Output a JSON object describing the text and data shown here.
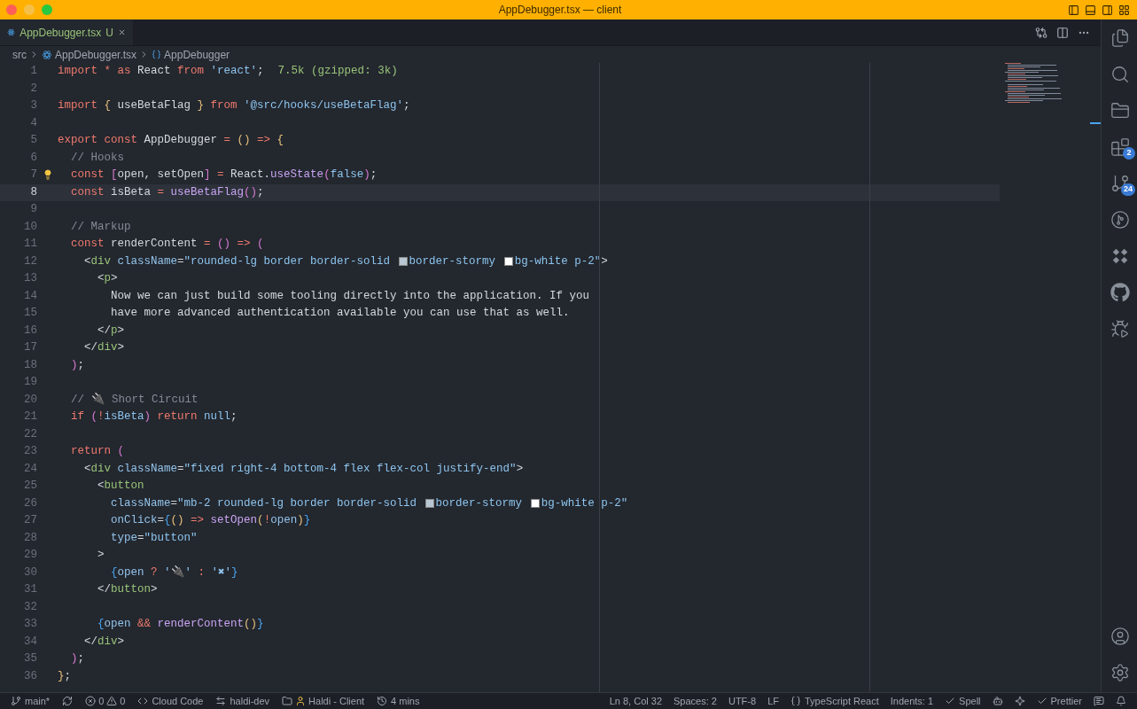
{
  "window": {
    "title": "AppDebugger.tsx — client"
  },
  "tabs": [
    {
      "label": "AppDebugger.tsx",
      "status": "U",
      "selected": true
    }
  ],
  "breadcrumb": [
    "src",
    "AppDebugger.tsx",
    "AppDebugger"
  ],
  "lines": [
    {
      "number": "1",
      "current": false,
      "tokens": [
        {
          "kind": "kw",
          "text": "import "
        },
        {
          "kind": "op",
          "text": "* "
        },
        {
          "kind": "kw",
          "text": "as "
        },
        {
          "kind": "id",
          "text": "React "
        },
        {
          "kind": "kw",
          "text": "from "
        },
        {
          "kind": "str",
          "text": "'react'"
        },
        {
          "kind": "id",
          "text": ";"
        },
        {
          "kind": "hint",
          "text": "7.5k (gzipped: 3k)"
        }
      ]
    },
    {
      "number": "2",
      "current": false
    },
    {
      "number": "3",
      "current": false,
      "tokens": [
        {
          "kind": "kw",
          "text": "import "
        },
        {
          "kind": "b1",
          "text": "{ "
        },
        {
          "kind": "id",
          "text": "useBetaFlag "
        },
        {
          "kind": "b1",
          "text": "} "
        },
        {
          "kind": "kw",
          "text": "from "
        },
        {
          "kind": "str",
          "text": "'@src/hooks/useBetaFlag'"
        },
        {
          "kind": "id",
          "text": ";"
        }
      ]
    },
    {
      "number": "4",
      "current": false
    },
    {
      "number": "5",
      "current": false,
      "tokens": [
        {
          "kind": "kw",
          "text": "export const "
        },
        {
          "kind": "id",
          "text": "AppDebugger "
        },
        {
          "kind": "op",
          "text": "= "
        },
        {
          "kind": "b1",
          "text": "() "
        },
        {
          "kind": "op",
          "text": "=> "
        },
        {
          "kind": "b1",
          "text": "{"
        }
      ]
    },
    {
      "number": "6",
      "current": false,
      "tokens": [
        {
          "kind": "com",
          "text": "  // Hooks"
        }
      ]
    },
    {
      "number": "7",
      "current": false,
      "lightbulb": true,
      "tokens": [
        {
          "kind": "kw",
          "text": "  const "
        },
        {
          "kind": "b2",
          "text": "["
        },
        {
          "kind": "id",
          "text": "open, setOpen"
        },
        {
          "kind": "b2",
          "text": "] "
        },
        {
          "kind": "op",
          "text": "= "
        },
        {
          "kind": "id",
          "text": "React."
        },
        {
          "kind": "fn",
          "text": "useState"
        },
        {
          "kind": "b2",
          "text": "("
        },
        {
          "kind": "var",
          "text": "false"
        },
        {
          "kind": "b2",
          "text": ")"
        },
        {
          "kind": "id",
          "text": ";"
        }
      ]
    },
    {
      "number": "8",
      "current": true,
      "tokens": [
        {
          "kind": "kw",
          "text": "  const "
        },
        {
          "kind": "id",
          "text": "isBeta "
        },
        {
          "kind": "op",
          "text": "= "
        },
        {
          "kind": "fn",
          "text": "useBetaFlag"
        },
        {
          "kind": "b2",
          "text": "()"
        },
        {
          "kind": "id",
          "text": ";"
        }
      ]
    },
    {
      "number": "9",
      "current": false
    },
    {
      "number": "10",
      "current": false,
      "tokens": [
        {
          "kind": "com",
          "text": "  // Markup"
        }
      ]
    },
    {
      "number": "11",
      "current": false,
      "tokens": [
        {
          "kind": "kw",
          "text": "  const "
        },
        {
          "kind": "id",
          "text": "renderContent "
        },
        {
          "kind": "op",
          "text": "= "
        },
        {
          "kind": "b2",
          "text": "() "
        },
        {
          "kind": "op",
          "text": "=> "
        },
        {
          "kind": "b2",
          "text": "("
        }
      ]
    },
    {
      "number": "12",
      "current": false,
      "tokens": [
        {
          "kind": "id",
          "text": "    <"
        },
        {
          "kind": "tag",
          "text": "div "
        },
        {
          "kind": "attr",
          "text": "className"
        },
        {
          "kind": "id",
          "text": "="
        },
        {
          "kind": "str",
          "text": "\"rounded-lg border border-solid "
        },
        {
          "kind": "swatch",
          "color": "#b8c7d2"
        },
        {
          "kind": "str",
          "text": "border-stormy "
        },
        {
          "kind": "swatch",
          "color": "#ffffff"
        },
        {
          "kind": "str",
          "text": "bg-white p-2\""
        },
        {
          "kind": "id",
          "text": ">"
        }
      ]
    },
    {
      "number": "13",
      "current": false,
      "tokens": [
        {
          "kind": "id",
          "text": "      <"
        },
        {
          "kind": "tag",
          "text": "p"
        },
        {
          "kind": "id",
          "text": ">"
        }
      ]
    },
    {
      "number": "14",
      "current": false,
      "tokens": [
        {
          "kind": "id",
          "text": "        Now we can just build some tooling directly into the application. If you"
        }
      ]
    },
    {
      "number": "15",
      "current": false,
      "tokens": [
        {
          "kind": "id",
          "text": "        have more advanced authentication available you can use that as well."
        }
      ]
    },
    {
      "number": "16",
      "current": false,
      "tokens": [
        {
          "kind": "id",
          "text": "      </"
        },
        {
          "kind": "tag",
          "text": "p"
        },
        {
          "kind": "id",
          "text": ">"
        }
      ]
    },
    {
      "number": "17",
      "current": false,
      "tokens": [
        {
          "kind": "id",
          "text": "    </"
        },
        {
          "kind": "tag",
          "text": "div"
        },
        {
          "kind": "id",
          "text": ">"
        }
      ]
    },
    {
      "number": "18",
      "current": false,
      "tokens": [
        {
          "kind": "b2",
          "text": "  )"
        },
        {
          "kind": "id",
          "text": ";"
        }
      ]
    },
    {
      "number": "19",
      "current": false
    },
    {
      "number": "20",
      "current": false,
      "tokens": [
        {
          "kind": "com",
          "text": "  // 🔌 Short Circuit"
        }
      ]
    },
    {
      "number": "21",
      "current": false,
      "tokens": [
        {
          "kind": "kw",
          "text": "  if "
        },
        {
          "kind": "b2",
          "text": "("
        },
        {
          "kind": "op",
          "text": "!"
        },
        {
          "kind": "var",
          "text": "isBeta"
        },
        {
          "kind": "b2",
          "text": ") "
        },
        {
          "kind": "kw",
          "text": "return "
        },
        {
          "kind": "var",
          "text": "null"
        },
        {
          "kind": "id",
          "text": ";"
        }
      ]
    },
    {
      "number": "22",
      "current": false
    },
    {
      "number": "23",
      "current": false,
      "tokens": [
        {
          "kind": "kw",
          "text": "  return "
        },
        {
          "kind": "b2",
          "text": "("
        }
      ]
    },
    {
      "number": "24",
      "current": false,
      "tokens": [
        {
          "kind": "id",
          "text": "    <"
        },
        {
          "kind": "tag",
          "text": "div "
        },
        {
          "kind": "attr",
          "text": "className"
        },
        {
          "kind": "id",
          "text": "="
        },
        {
          "kind": "str",
          "text": "\"fixed right-4 bottom-4 flex flex-col justify-end\""
        },
        {
          "kind": "id",
          "text": ">"
        }
      ]
    },
    {
      "number": "25",
      "current": false,
      "tokens": [
        {
          "kind": "id",
          "text": "      <"
        },
        {
          "kind": "tag",
          "text": "button"
        }
      ]
    },
    {
      "number": "26",
      "current": false,
      "tokens": [
        {
          "kind": "attr",
          "text": "        className"
        },
        {
          "kind": "id",
          "text": "="
        },
        {
          "kind": "str",
          "text": "\"mb-2 rounded-lg border border-solid "
        },
        {
          "kind": "swatch",
          "color": "#b8c7d2"
        },
        {
          "kind": "str",
          "text": "border-stormy "
        },
        {
          "kind": "swatch",
          "color": "#ffffff"
        },
        {
          "kind": "str",
          "text": "bg-white p-2\""
        }
      ]
    },
    {
      "number": "27",
      "current": false,
      "tokens": [
        {
          "kind": "attr",
          "text": "        onClick"
        },
        {
          "kind": "id",
          "text": "="
        },
        {
          "kind": "b3",
          "text": "{"
        },
        {
          "kind": "b1",
          "text": "() "
        },
        {
          "kind": "op",
          "text": "=> "
        },
        {
          "kind": "fn",
          "text": "setOpen"
        },
        {
          "kind": "b1",
          "text": "("
        },
        {
          "kind": "op",
          "text": "!"
        },
        {
          "kind": "attr",
          "text": "open"
        },
        {
          "kind": "b1",
          "text": ")"
        },
        {
          "kind": "b3",
          "text": "}"
        }
      ]
    },
    {
      "number": "28",
      "current": false,
      "tokens": [
        {
          "kind": "attr",
          "text": "        type"
        },
        {
          "kind": "id",
          "text": "="
        },
        {
          "kind": "str",
          "text": "\"button\""
        }
      ]
    },
    {
      "number": "29",
      "current": false,
      "tokens": [
        {
          "kind": "id",
          "text": "      >"
        }
      ]
    },
    {
      "number": "30",
      "current": false,
      "tokens": [
        {
          "kind": "b3",
          "text": "        {"
        },
        {
          "kind": "attr",
          "text": "open "
        },
        {
          "kind": "op",
          "text": "? "
        },
        {
          "kind": "str",
          "text": "'🔌' "
        },
        {
          "kind": "op",
          "text": ": "
        },
        {
          "kind": "str",
          "text": "'✖'"
        },
        {
          "kind": "b3",
          "text": "}"
        }
      ]
    },
    {
      "number": "31",
      "current": false,
      "tokens": [
        {
          "kind": "id",
          "text": "      </"
        },
        {
          "kind": "tag",
          "text": "button"
        },
        {
          "kind": "id",
          "text": ">"
        }
      ]
    },
    {
      "number": "32",
      "current": false
    },
    {
      "number": "33",
      "current": false,
      "tokens": [
        {
          "kind": "b3",
          "text": "      {"
        },
        {
          "kind": "attr",
          "text": "open "
        },
        {
          "kind": "op",
          "text": "&& "
        },
        {
          "kind": "fn",
          "text": "renderContent"
        },
        {
          "kind": "b1",
          "text": "()"
        },
        {
          "kind": "b3",
          "text": "}"
        }
      ]
    },
    {
      "number": "34",
      "current": false,
      "tokens": [
        {
          "kind": "id",
          "text": "    </"
        },
        {
          "kind": "tag",
          "text": "div"
        },
        {
          "kind": "id",
          "text": ">"
        }
      ]
    },
    {
      "number": "35",
      "current": false,
      "tokens": [
        {
          "kind": "b2",
          "text": "  )"
        },
        {
          "kind": "id",
          "text": ";"
        }
      ]
    },
    {
      "number": "36",
      "current": false,
      "tokens": [
        {
          "kind": "b1",
          "text": "}"
        },
        {
          "kind": "id",
          "text": ";"
        }
      ]
    }
  ],
  "activity_bar": [
    {
      "kind": "explorer"
    },
    {
      "kind": "search"
    },
    {
      "kind": "folders"
    },
    {
      "kind": "extensions",
      "badge": "2"
    },
    {
      "kind": "source-control",
      "badge": "24"
    },
    {
      "kind": "git-graph"
    },
    {
      "kind": "diamonds"
    },
    {
      "kind": "github"
    },
    {
      "kind": "run-debug"
    }
  ],
  "activity_bottom": [
    {
      "kind": "account"
    },
    {
      "kind": "settings"
    }
  ],
  "status_left": [
    {
      "kind": "branch",
      "text": "main*"
    },
    {
      "kind": "sync"
    },
    {
      "kind": "problems",
      "errors": "0",
      "warnings": "0"
    },
    {
      "kind": "code",
      "text": "Cloud Code"
    },
    {
      "kind": "switch",
      "text": "haldi-dev"
    },
    {
      "kind": "folder-person",
      "text": "Haldi - Client"
    },
    {
      "kind": "history",
      "text": "4 mins"
    }
  ],
  "status_right": [
    {
      "kind": "plain",
      "text": "Ln 8, Col 32"
    },
    {
      "kind": "plain",
      "text": "Spaces: 2"
    },
    {
      "kind": "plain",
      "text": "UTF-8"
    },
    {
      "kind": "plain",
      "text": "LF"
    },
    {
      "kind": "braces",
      "text": "TypeScript React"
    },
    {
      "kind": "plain",
      "text": "Indents: 1"
    },
    {
      "kind": "check",
      "text": "Spell"
    },
    {
      "kind": "copilot"
    },
    {
      "kind": "gear-star"
    },
    {
      "kind": "check",
      "text": "Prettier"
    },
    {
      "kind": "feedback"
    },
    {
      "kind": "bell"
    }
  ]
}
